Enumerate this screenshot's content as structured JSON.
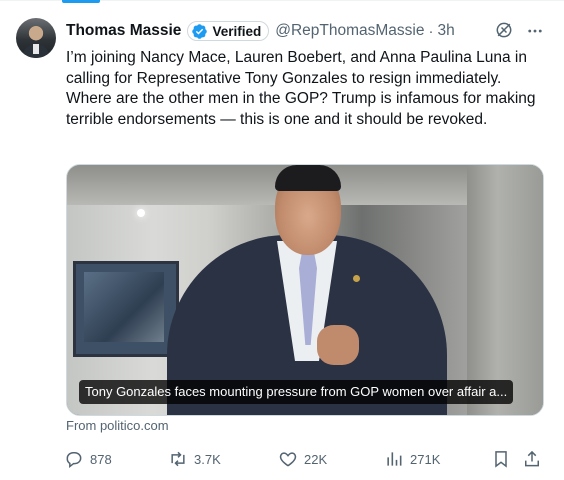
{
  "tweet": {
    "author_name": "Thomas Massie",
    "verified_label": "Verified",
    "handle": "@RepThomasMassie",
    "separator": "·",
    "time": "3h",
    "text": "I’m joining Nancy Mace, Lauren Boebert, and Anna Paulina Luna in calling for Representative Tony Gonzales to resign immediately. Where are the other men in the GOP? Trump is infamous for making terrible endorsements — this is one and it should be revoked."
  },
  "card": {
    "caption": "Tony Gonzales faces mounting pressure from GOP women over affair a...",
    "source": "From politico.com"
  },
  "actions": {
    "replies": "878",
    "reposts": "3.7K",
    "likes": "22K",
    "views": "271K"
  },
  "icons": {
    "verified": "verified-badge-icon",
    "grok": "grok-icon",
    "more": "more-icon",
    "reply": "reply-icon",
    "repost": "repost-icon",
    "like": "heart-icon",
    "views": "views-icon",
    "bookmark": "bookmark-icon",
    "share": "share-icon"
  },
  "colors": {
    "accent": "#1d9bf0",
    "text": "#0f1419",
    "secondary": "#536471"
  }
}
